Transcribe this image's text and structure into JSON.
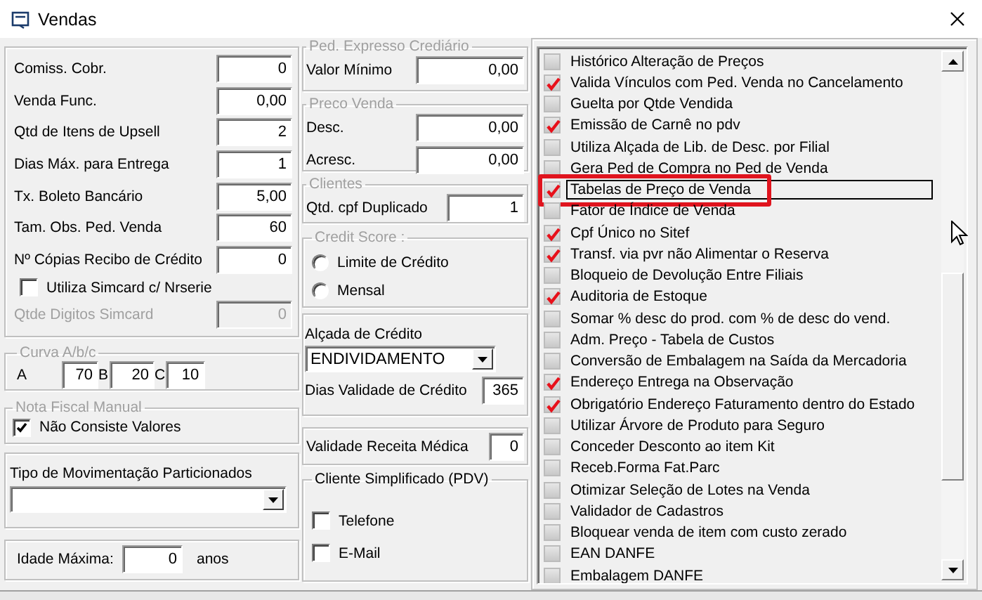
{
  "window": {
    "title": "Vendas"
  },
  "general": {
    "items": [
      {
        "kind": "field",
        "label": "Comiss. Cobr.",
        "value": "0",
        "disabled": false
      },
      {
        "kind": "field",
        "label": "Venda Func.",
        "value": "0,00",
        "disabled": false
      },
      {
        "kind": "field",
        "label": "Qtd de Itens de Upsell",
        "value": "2",
        "disabled": false
      },
      {
        "kind": "field",
        "label": "Dias Máx. para Entrega",
        "value": "1",
        "disabled": false
      },
      {
        "kind": "field",
        "label": "Tx. Boleto Bancário",
        "value": "5,00",
        "disabled": false
      },
      {
        "kind": "field",
        "label": "Tam. Obs. Ped. Venda",
        "value": "60",
        "disabled": false
      },
      {
        "kind": "field",
        "label": "Nº Cópias Recibo de Crédito",
        "value": "0",
        "disabled": false
      },
      {
        "kind": "checkbox",
        "label": "Utiliza Simcard c/ Nrserie",
        "checked": false
      },
      {
        "kind": "field",
        "label": "Qtde Digitos Simcard",
        "value": "0",
        "disabled": true
      }
    ]
  },
  "curva": {
    "title": "Curva A/b/c",
    "title_disabled": true,
    "fields": [
      {
        "label": "A",
        "value": "70"
      },
      {
        "label": "B",
        "value": "20"
      },
      {
        "label": "C",
        "value": "10"
      }
    ]
  },
  "nota_fiscal": {
    "title": "Nota Fiscal Manual",
    "title_disabled": true,
    "checkbox": {
      "label": "Não Consiste Valores",
      "checked": true
    }
  },
  "tipo_movimentacao": {
    "label": "Tipo de Movimentação Particionados"
  },
  "idade": {
    "label": "Idade Máxima:",
    "value": "0",
    "unit": "anos"
  },
  "ped_expresso": {
    "title": "Ped. Expresso Crediário",
    "title_disabled": true,
    "fields": [
      {
        "label": "Valor Mínimo",
        "value": "0,00"
      }
    ]
  },
  "preco_venda": {
    "title": "Preco Venda",
    "title_disabled": true,
    "fields": [
      {
        "label": "Desc.",
        "value": "0,00"
      },
      {
        "label": "Acresc.",
        "value": "0,00"
      }
    ]
  },
  "clientes": {
    "title": "Clientes",
    "title_disabled": true,
    "fields": [
      {
        "label": "Qtd. cpf Duplicado",
        "value": "1"
      }
    ]
  },
  "credit_score": {
    "title": "Credit Score  :",
    "title_disabled": true,
    "options": [
      {
        "label": "Limite de Crédito",
        "selected": false
      },
      {
        "label": "Mensal",
        "selected": false
      }
    ]
  },
  "alcada": {
    "label": "Alçada de Crédito",
    "dropdown": "ENDIVIDAMENTO",
    "field": {
      "label": "Dias Validade de Crédito",
      "value": "365"
    }
  },
  "validade_receita": {
    "label": "Validade Receita Médica",
    "value": "0"
  },
  "cliente_simplificado": {
    "title": "Cliente Simplificado (PDV)",
    "title_disabled": false,
    "options": [
      {
        "label": "Telefone",
        "checked": false
      },
      {
        "label": "E-Mail",
        "checked": false
      }
    ]
  },
  "options": [
    {
      "label": "Histórico Alteração de Preços",
      "checked": false,
      "focused": false,
      "highlighted": false
    },
    {
      "label": "Valida Vínculos com Ped. Venda no Cancelamento",
      "checked": true,
      "focused": false,
      "highlighted": false
    },
    {
      "label": "Guelta por Qtde Vendida",
      "checked": false,
      "focused": false,
      "highlighted": false
    },
    {
      "label": "Emissão de Carnê no pdv",
      "checked": true,
      "focused": false,
      "highlighted": false
    },
    {
      "label": "Utiliza Alçada de Lib. de Desc. por Filial",
      "checked": false,
      "focused": false,
      "highlighted": false
    },
    {
      "label": "Gera Ped de Compra no Ped de Venda",
      "checked": false,
      "focused": false,
      "highlighted": false
    },
    {
      "label": "Tabelas de Preço de Venda",
      "checked": true,
      "focused": true,
      "highlighted": true
    },
    {
      "label": "Fator de Índice de Venda",
      "checked": false,
      "focused": false,
      "highlighted": false
    },
    {
      "label": "Cpf Único no Sitef",
      "checked": true,
      "focused": false,
      "highlighted": false
    },
    {
      "label": "Transf. via pvr não Alimentar o Reserva",
      "checked": true,
      "focused": false,
      "highlighted": false
    },
    {
      "label": "Bloqueio de Devolução Entre Filiais",
      "checked": false,
      "focused": false,
      "highlighted": false
    },
    {
      "label": "Auditoria de Estoque",
      "checked": true,
      "focused": false,
      "highlighted": false
    },
    {
      "label": "Somar % desc do prod. com % de desc do vend.",
      "checked": false,
      "focused": false,
      "highlighted": false
    },
    {
      "label": "Adm. Preço - Tabela de Custos",
      "checked": false,
      "focused": false,
      "highlighted": false
    },
    {
      "label": "Conversão de Embalagem na Saída da Mercadoria",
      "checked": false,
      "focused": false,
      "highlighted": false
    },
    {
      "label": "Endereço Entrega na Observação",
      "checked": true,
      "focused": false,
      "highlighted": false
    },
    {
      "label": "Obrigatório Endereço Faturamento dentro do Estado",
      "checked": true,
      "focused": false,
      "highlighted": false
    },
    {
      "label": "Utilizar Árvore de Produto para Seguro",
      "checked": false,
      "focused": false,
      "highlighted": false
    },
    {
      "label": "Conceder Desconto ao item Kit",
      "checked": false,
      "focused": false,
      "highlighted": false
    },
    {
      "label": "Receb.Forma Fat.Parc",
      "checked": false,
      "focused": false,
      "highlighted": false
    },
    {
      "label": "Otimizar Seleção de Lotes na Venda",
      "checked": false,
      "focused": false,
      "highlighted": false
    },
    {
      "label": "Validador de Cadastros",
      "checked": false,
      "focused": false,
      "highlighted": false
    },
    {
      "label": "Bloquear venda de item com custo zerado",
      "checked": false,
      "focused": false,
      "highlighted": false
    },
    {
      "label": "EAN DANFE",
      "checked": false,
      "focused": false,
      "highlighted": false
    },
    {
      "label": "Embalagem DANFE",
      "checked": false,
      "focused": false,
      "highlighted": false
    }
  ]
}
